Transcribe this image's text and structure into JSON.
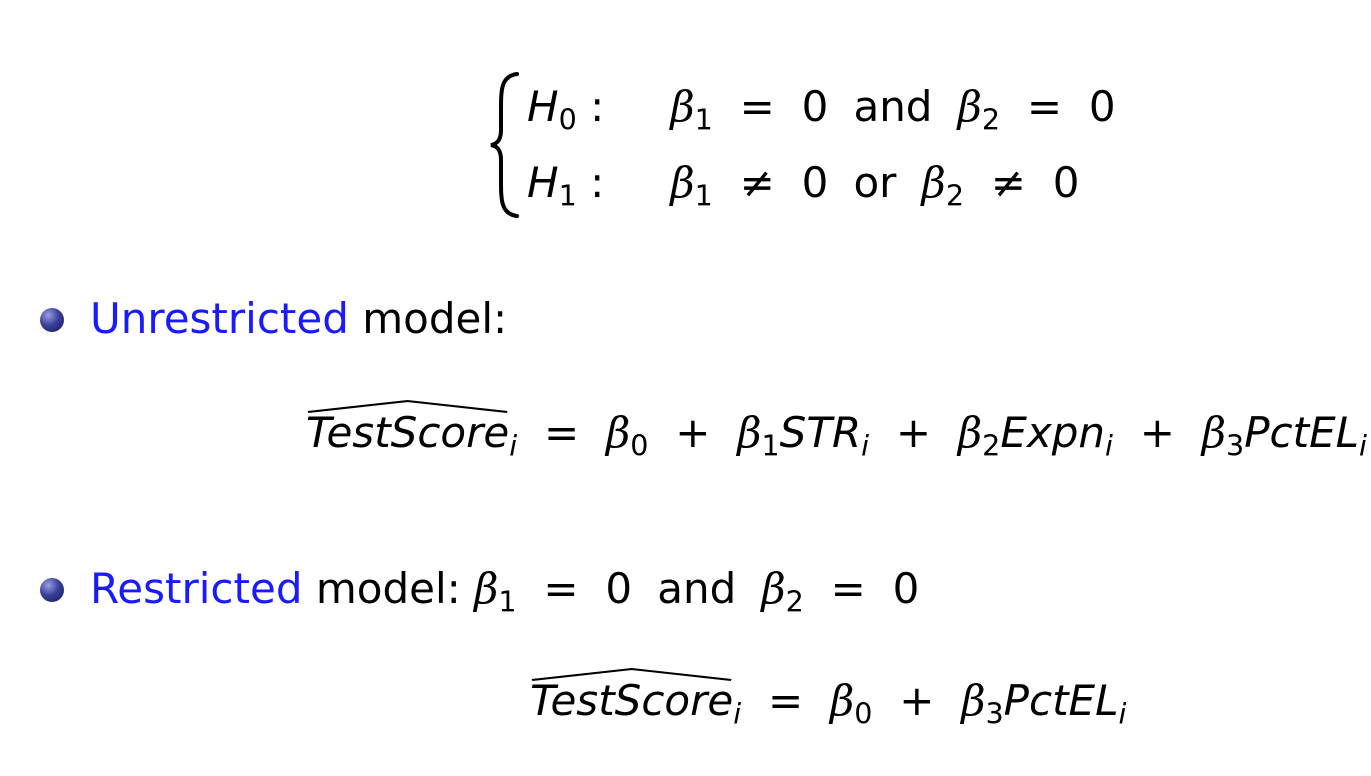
{
  "hypotheses": {
    "h0": {
      "label_sym": "H",
      "label_sub": "0",
      "colon": ":",
      "b1_sym": "β",
      "b1_sub": "1",
      "b1_rel": "=",
      "b1_val": "0",
      "connector": "and",
      "b2_sym": "β",
      "b2_sub": "2",
      "b2_rel": "=",
      "b2_val": "0"
    },
    "h1": {
      "label_sym": "H",
      "label_sub": "1",
      "colon": ":",
      "b1_sym": "β",
      "b1_sub": "1",
      "b1_rel": "≠",
      "b1_val": "0",
      "connector": "or",
      "b2_sym": "β",
      "b2_sub": "2",
      "b2_rel": "≠",
      "b2_val": "0"
    }
  },
  "bullets": [
    {
      "keyword": "Unrestricted",
      "rest": " model:"
    },
    {
      "keyword": "Restricted",
      "rest": " model: ",
      "cond_b1": "β",
      "cond_b1_sub": "1",
      "cond_eq1": "=",
      "cond_val1": "0",
      "cond_connector": "and",
      "cond_b2": "β",
      "cond_b2_sub": "2",
      "cond_eq2": "=",
      "cond_val2": "0"
    }
  ],
  "equations": {
    "unrestricted": {
      "lhs": "TestScore",
      "lhs_sub": "i",
      "eq": "=",
      "b0": "β",
      "b0_sub": "0",
      "plus1": "+",
      "b1": "β",
      "b1_sub": "1",
      "v1": "STR",
      "v1_sub": "i",
      "plus2": "+",
      "b2": "β",
      "b2_sub": "2",
      "v2": "Expn",
      "v2_sub": "i",
      "plus3": "+",
      "b3": "β",
      "b3_sub": "3",
      "v3": "PctEL",
      "v3_sub": "i"
    },
    "restricted": {
      "lhs": "TestScore",
      "lhs_sub": "i",
      "eq": "=",
      "b0": "β",
      "b0_sub": "0",
      "plus1": "+",
      "b3": "β",
      "b3_sub": "3",
      "v3": "PctEL",
      "v3_sub": "i"
    }
  },
  "colors": {
    "keyword": "#1a1aff",
    "text": "#000000",
    "bullet": "#2a2d86"
  }
}
